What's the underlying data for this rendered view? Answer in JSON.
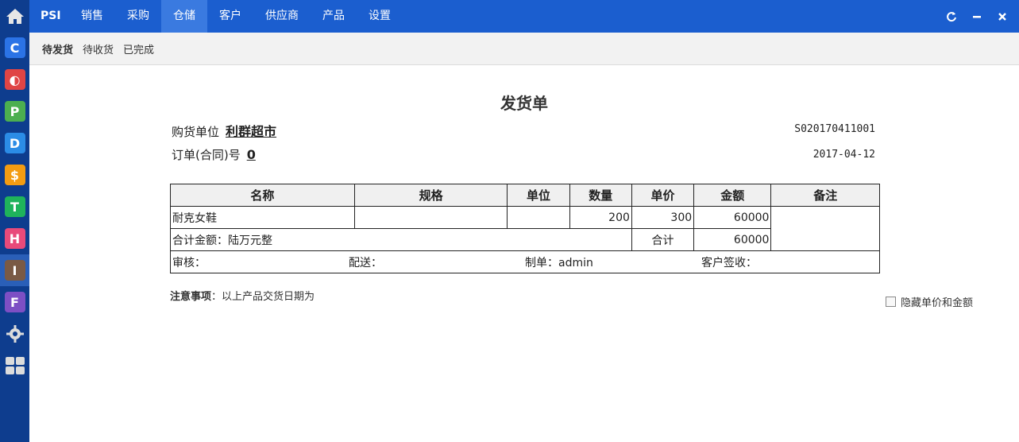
{
  "rail": {
    "apps": [
      {
        "glyph": "C",
        "color": "#2b73e6",
        "icon": "c-app-icon"
      },
      {
        "glyph": "◐",
        "color": "#e04545",
        "icon": "half-circle-app-icon"
      },
      {
        "glyph": "P",
        "color": "#4caf50",
        "icon": "p-app-icon"
      },
      {
        "glyph": "D",
        "color": "#2b8ce6",
        "icon": "d-app-icon"
      },
      {
        "glyph": "$",
        "color": "#f39c12",
        "icon": "dollar-app-icon"
      },
      {
        "glyph": "T",
        "color": "#1fb35b",
        "icon": "t-app-icon"
      },
      {
        "glyph": "H",
        "color": "#e84a7a",
        "icon": "h-app-icon"
      },
      {
        "glyph": "I",
        "color": "#7a5a45",
        "icon": "i-app-icon"
      },
      {
        "glyph": "F",
        "color": "#7d4fc4",
        "icon": "f-app-icon"
      }
    ]
  },
  "topbar": {
    "brand": "PSI",
    "nav": [
      "销售",
      "采购",
      "仓储",
      "客户",
      "供应商",
      "产品",
      "设置"
    ],
    "active_nav": 2
  },
  "subbar": {
    "items": [
      "待发货",
      "待收货",
      "已完成"
    ],
    "active": 0
  },
  "doc": {
    "title": "发货单",
    "buyer_label": "购货单位",
    "buyer": "利群超市",
    "order_label": "订单(合同)号",
    "order_no": "0",
    "doc_no": "S020170411001",
    "date": "2017-04-12"
  },
  "table": {
    "headers": [
      "名称",
      "规格",
      "单位",
      "数量",
      "单价",
      "金额",
      "备注"
    ],
    "row": {
      "name": "耐克女鞋",
      "spec": "",
      "unit": "",
      "qty": "200",
      "price": "300",
      "amount": "60000",
      "remark": ""
    },
    "total_text": "合计金额：陆万元整",
    "total_label": "合计",
    "total_amount": "60000",
    "sig": [
      "审核：",
      "配送：",
      "制单：admin",
      "客户签收："
    ]
  },
  "notice": {
    "label": "注意事项",
    "text": "：以上产品交货日期为"
  },
  "hide_option": "隐藏单价和金额"
}
